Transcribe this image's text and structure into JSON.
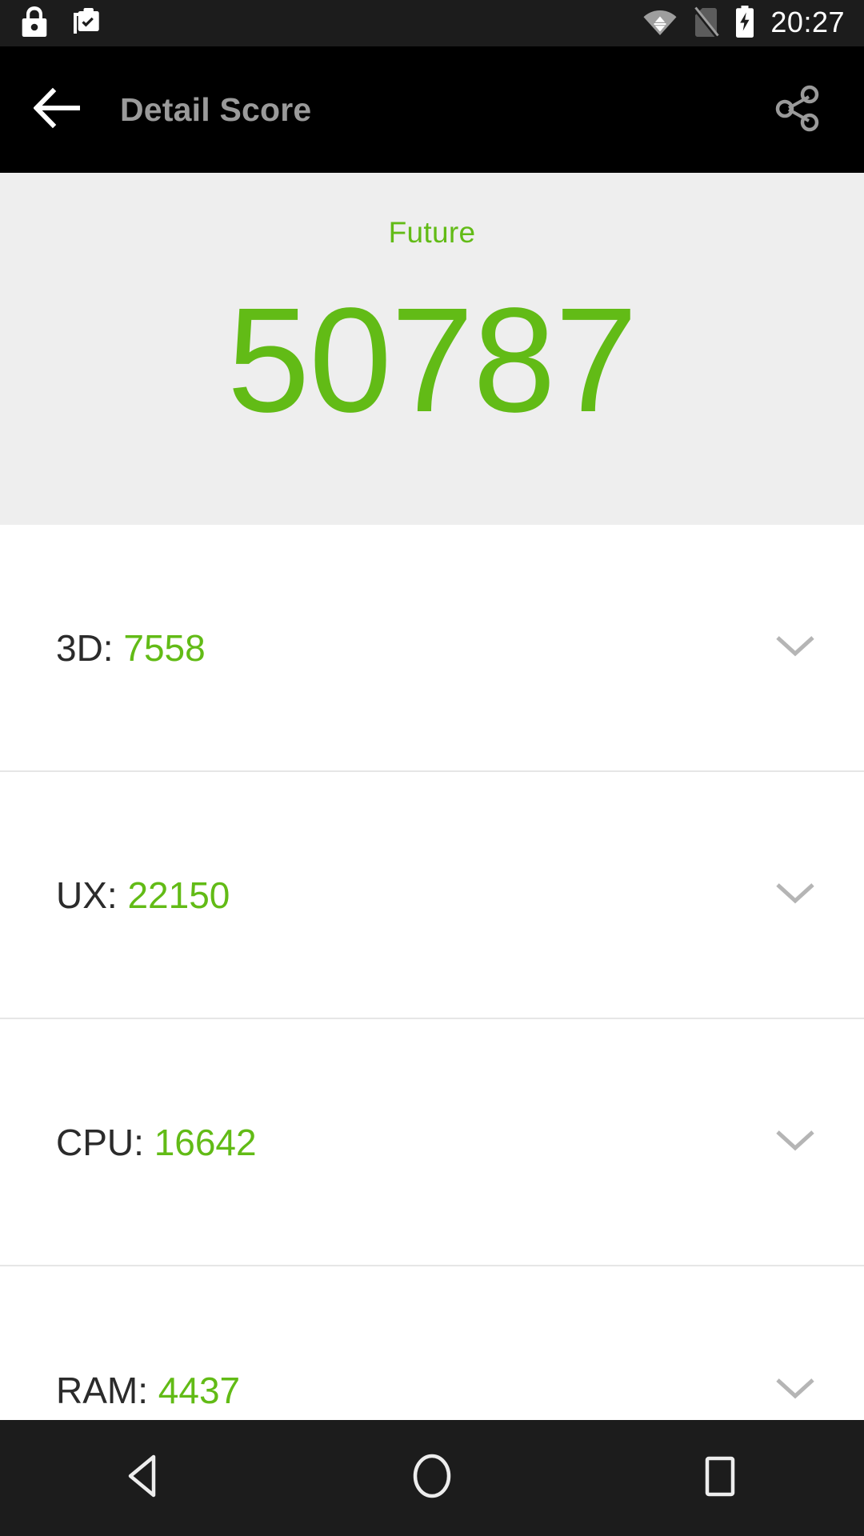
{
  "status_bar": {
    "time": "20:27",
    "icons": [
      "lock-icon",
      "work-profile-check-icon",
      "wifi-icon",
      "no-sim-icon",
      "battery-charging-icon"
    ]
  },
  "app_bar": {
    "back_label": "back-arrow-icon",
    "title": "Detail Score",
    "share_label": "share-icon",
    "title_color": "#9a9a9a",
    "background_color": "#000000"
  },
  "hero": {
    "label": "Future",
    "score": "50787",
    "accent_color": "#62bb16",
    "background_color": "#eeeeee"
  },
  "scores": [
    {
      "key": "3D:",
      "value": "7558",
      "expand_icon": "chevron-down-icon"
    },
    {
      "key": "UX:",
      "value": "22150",
      "expand_icon": "chevron-down-icon"
    },
    {
      "key": "CPU:",
      "value": "16642",
      "expand_icon": "chevron-down-icon"
    },
    {
      "key": "RAM:",
      "value": "4437",
      "expand_icon": "chevron-down-icon"
    }
  ],
  "nav_bar": {
    "back": "nav-back-icon",
    "home": "nav-home-icon",
    "recents": "nav-recents-icon"
  }
}
